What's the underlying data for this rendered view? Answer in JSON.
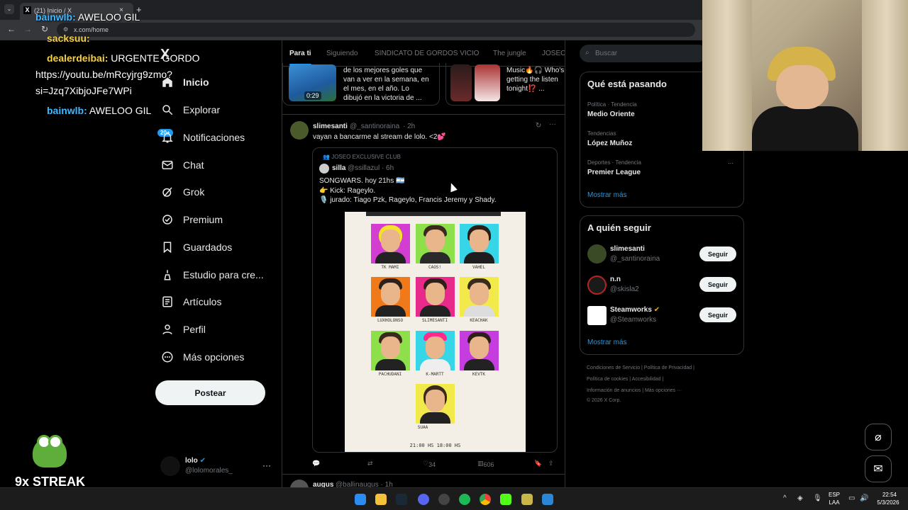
{
  "browser": {
    "tab_title": "(21) Inicio / X",
    "tab_close": "×",
    "new_tab": "+",
    "url": "x.com/home"
  },
  "sidebar": {
    "logo": "X",
    "items": [
      {
        "label": "Inicio",
        "icon": "home-icon"
      },
      {
        "label": "Explorar",
        "icon": "search-icon"
      },
      {
        "label": "Notificaciones",
        "icon": "bell-icon",
        "badge": "20+"
      },
      {
        "label": "Chat",
        "icon": "mail-icon"
      },
      {
        "label": "Grok",
        "icon": "grok-icon"
      },
      {
        "label": "Premium",
        "icon": "verified-icon"
      },
      {
        "label": "Guardados",
        "icon": "bookmark-icon"
      },
      {
        "label": "Estudio para cre...",
        "icon": "studio-icon"
      },
      {
        "label": "Artículos",
        "icon": "article-icon"
      },
      {
        "label": "Perfil",
        "icon": "person-icon"
      },
      {
        "label": "Más opciones",
        "icon": "more-icon"
      }
    ],
    "post_button": "Postear",
    "account": {
      "name": "lolo",
      "handle": "@lolomorales_",
      "more": "···"
    }
  },
  "feed": {
    "tabs": [
      "Para ti",
      "Siguiendo",
      "SINDICATO DE GORDOS VICIO",
      "The jungle",
      "JOSEO"
    ],
    "cards": [
      {
        "text": "de los mejores goles que van a ver en la semana, en el mes, en el año. Lo dibujó en la victoria de ...",
        "duration": "0:29"
      },
      {
        "text": "Music🔥🎧 Who's getting the listen tonight⁉️ ..."
      }
    ],
    "tweet": {
      "name": "slimesanti",
      "handle": "@_santinoraina",
      "time": "· 2h",
      "text": "vayan a bancarme al stream de lolo. <2💕",
      "quote": {
        "community": "JOSEO EXCLUSIVE CLUB",
        "name": "silla",
        "handle": "@ssillazul · 6h",
        "line1": "SONGWARS. hoy 21hs 🇦🇷",
        "line2": "👉 Kick: Rageylo.",
        "line3": "🎙️ jurado: Tiago Pzk, Rageylo,  Francis Jeremy y Shady.",
        "poster": {
          "participants": [
            "TK MAMI",
            "CAOS!",
            "VAHEL",
            "LUXHOLONSO",
            "SLIMESANTI",
            "KEACHAK",
            "PACHUDANI",
            "K-MARTT",
            "KEVTK",
            "SUAA"
          ],
          "times": "21:00 HS     18:00 HS"
        }
      },
      "actions": {
        "likes": "34",
        "views": "606"
      }
    },
    "next_tweet": {
      "name": "augus",
      "handle": "@ballinaugus · 1h"
    }
  },
  "right": {
    "search_placeholder": "Buscar",
    "trends_title": "Qué está pasando",
    "trends": [
      {
        "meta": "Política · Tendencia",
        "name": "Medio Oriente"
      },
      {
        "meta": "Tendencias",
        "name": "López Muñoz"
      },
      {
        "meta": "Deportes · Tendencia",
        "name": "Premier League"
      }
    ],
    "trends_more": "Mostrar más",
    "follow_title": "A quién seguir",
    "follow": [
      {
        "name": "slimesanti",
        "handle": "@_santinoraina",
        "button": "Seguir"
      },
      {
        "name": "n.n",
        "handle": "@skisla2",
        "button": "Seguir"
      },
      {
        "name": "Steamworks",
        "handle": "@Steamworks",
        "button": "Seguir"
      }
    ],
    "follow_more": "Mostrar más",
    "footer": {
      "line1": "Condiciones de Servicio  |  Política de Privacidad  |",
      "line2": "Política de cookies  |  Accesibilidad  |",
      "line3": "Información de anuncios  |  Más opciones ···",
      "line4": "© 2026 X Corp."
    }
  },
  "overlay": {
    "chat": [
      {
        "user": "bainwlb:",
        "text": " AWELOO GIL"
      },
      {
        "user": "sacksuu:",
        "text": ""
      },
      {
        "user": "dealerdeibai:",
        "text": " URGENTE GORDO"
      },
      {
        "user": "",
        "text": "https://youtu.be/mRcyjrg9zmo?"
      },
      {
        "user": "",
        "text": "si=Jzq7XibjoJFe7WPi"
      },
      {
        "user": "bainwlb:",
        "text": " AWELOO GIL"
      }
    ],
    "streak": "9x STREAK"
  },
  "taskbar": {
    "lang": "ESP",
    "lang2": "LAA",
    "time": "22:54",
    "date": "5/3/2026"
  }
}
